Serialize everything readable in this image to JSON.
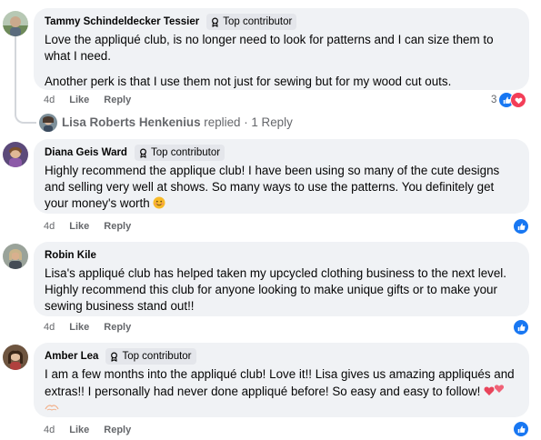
{
  "comments": [
    {
      "author": "Tammy Schindeldecker Tessier",
      "badge": "Top contributor",
      "paragraphs": [
        "Love the appliqué club, is no longer need to look for patterns and I can size them to what I need.",
        "Another perk is that I use them not just for sewing but for my wood cut outs."
      ],
      "age": "4d",
      "like": "Like",
      "reply": "Reply",
      "reaction_count": "3",
      "reactions": [
        "like-icon",
        "love-icon"
      ]
    },
    {
      "author": "Diana Geis Ward",
      "badge": "Top contributor",
      "text": "Highly recommend the applique club! I have been using so many of the cute designs and selling very well at shows. So many ways to use the patterns. You definitely get your money's worth ",
      "age": "4d",
      "like": "Like",
      "reply": "Reply",
      "reactions": [
        "like-icon"
      ]
    },
    {
      "author": "Robin Kile",
      "text": "Lisa's appliqué club has helped taken my upcycled clothing business to the next level. Highly recommend this club for anyone looking to make unique gifts or to make your sewing business stand out!!",
      "age": "4d",
      "like": "Like",
      "reply": "Reply",
      "reactions": [
        "like-icon"
      ]
    },
    {
      "author": "Amber Lea",
      "badge": "Top contributor",
      "text": "I am a few months into the appliqué club! Love it!! Lisa gives us amazing appliqués and extras!! I personally had never done appliqué before! So easy and easy to follow! ",
      "age": "4d",
      "like": "Like",
      "reply": "Reply",
      "reactions": [
        "like-icon"
      ]
    }
  ],
  "replied_line": {
    "author": "Lisa Roberts Henkenius",
    "suffix": " replied · 1 Reply"
  },
  "colors": {
    "like": "#1877f2",
    "love": "#f33e58",
    "bubble": "#f0f2f5",
    "secondary_text": "#65676b"
  }
}
